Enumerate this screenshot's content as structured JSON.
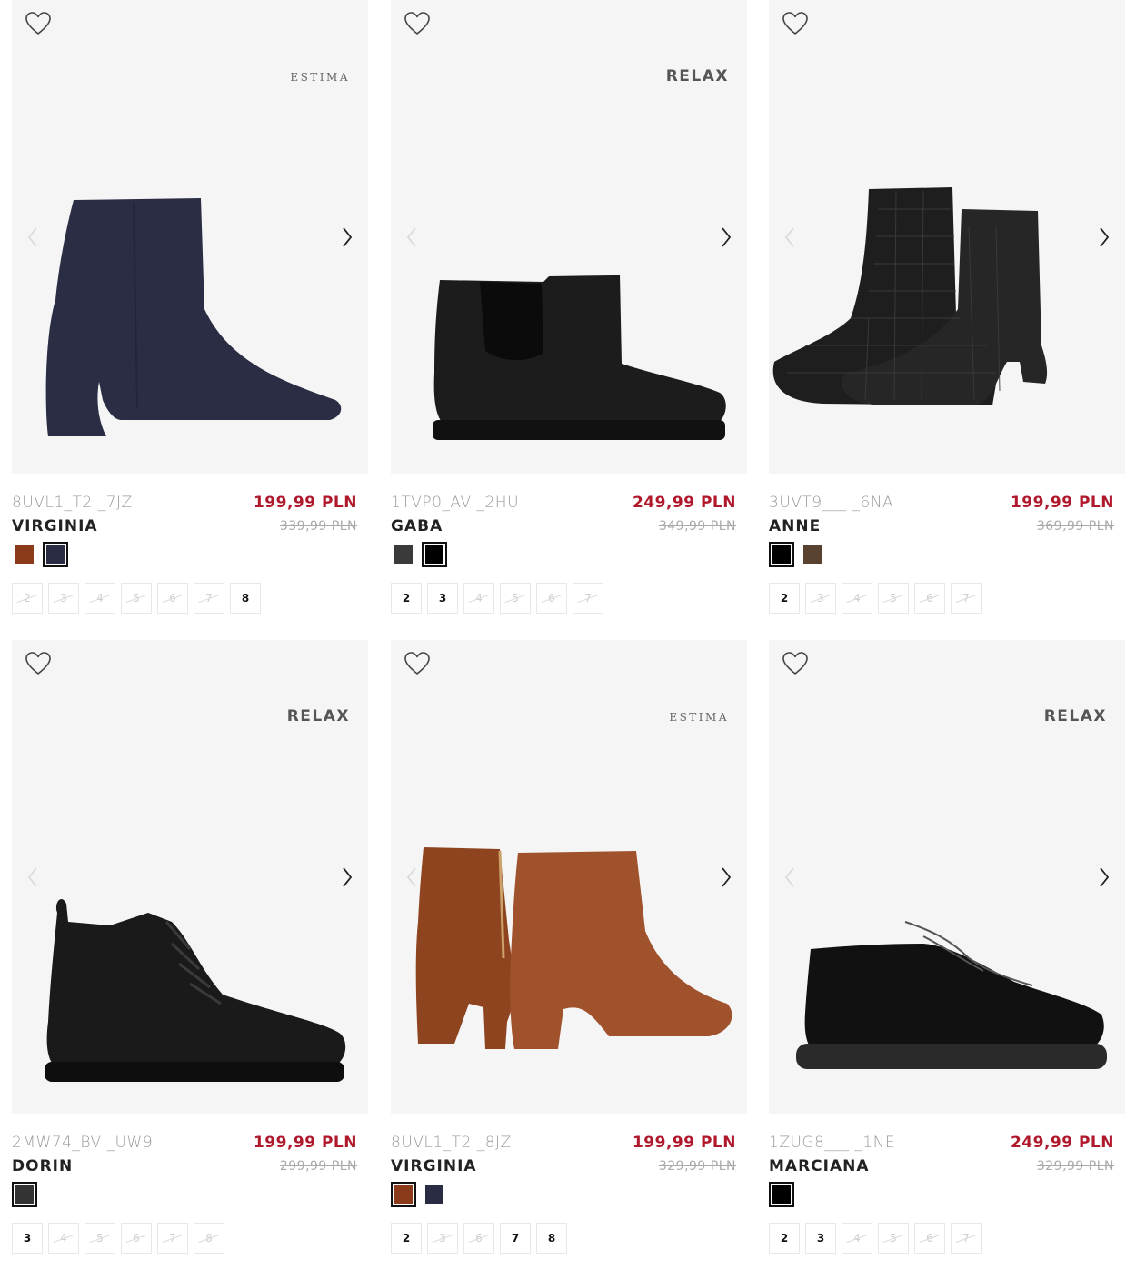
{
  "products": [
    {
      "sku": "8UVL1_T2 _7JZ",
      "name": "VIRGINIA",
      "price": "199,99 PLN",
      "old_price": "339,99 PLN",
      "brand": "ESTIMA",
      "brand_style": "serif",
      "shoe_type": "heel-ankle-boot",
      "shoe_color": "#2b2d45",
      "swatches": [
        {
          "color": "#8b3a1a",
          "selected": false
        },
        {
          "color": "#2a2c43",
          "selected": true
        }
      ],
      "sizes": [
        {
          "label": "2",
          "available": false
        },
        {
          "label": "3",
          "available": false
        },
        {
          "label": "4",
          "available": false
        },
        {
          "label": "5",
          "available": false
        },
        {
          "label": "6",
          "available": false
        },
        {
          "label": "7",
          "available": false
        },
        {
          "label": "8",
          "available": true
        }
      ]
    },
    {
      "sku": "1TVP0_AV _2HU",
      "name": "GABA",
      "price": "249,99 PLN",
      "old_price": "349,99 PLN",
      "brand": "RELAX",
      "brand_style": "sans",
      "shoe_type": "chelsea-boot",
      "shoe_color": "#1c1c1c",
      "swatches": [
        {
          "color": "#3a3a3a",
          "selected": false
        },
        {
          "color": "#000000",
          "selected": true
        }
      ],
      "sizes": [
        {
          "label": "2",
          "available": true
        },
        {
          "label": "3",
          "available": true
        },
        {
          "label": "4",
          "available": false
        },
        {
          "label": "5",
          "available": false
        },
        {
          "label": "6",
          "available": false
        },
        {
          "label": "7",
          "available": false
        }
      ]
    },
    {
      "sku": "3UVT9___ _6NA",
      "name": "ANNE",
      "price": "199,99 PLN",
      "old_price": "369,99 PLN",
      "brand": "",
      "brand_style": "sans",
      "shoe_type": "croc-boot-pair",
      "shoe_color": "#1e1e1e",
      "swatches": [
        {
          "color": "#000000",
          "selected": true
        },
        {
          "color": "#5a4230",
          "selected": false
        }
      ],
      "sizes": [
        {
          "label": "2",
          "available": true
        },
        {
          "label": "3",
          "available": false
        },
        {
          "label": "4",
          "available": false
        },
        {
          "label": "5",
          "available": false
        },
        {
          "label": "6",
          "available": false
        },
        {
          "label": "7",
          "available": false
        }
      ]
    },
    {
      "sku": "2MW74_BV _UW9",
      "name": "DORIN",
      "price": "199,99 PLN",
      "old_price": "299,99 PLN",
      "brand": "RELAX",
      "brand_style": "sans",
      "shoe_type": "lace-up-boot",
      "shoe_color": "#1a1a1a",
      "swatches": [
        {
          "color": "#333333",
          "selected": true
        }
      ],
      "sizes": [
        {
          "label": "3",
          "available": true
        },
        {
          "label": "4",
          "available": false
        },
        {
          "label": "5",
          "available": false
        },
        {
          "label": "6",
          "available": false
        },
        {
          "label": "7",
          "available": false
        },
        {
          "label": "8",
          "available": false
        }
      ]
    },
    {
      "sku": "8UVL1_T2 _8JZ",
      "name": "VIRGINIA",
      "price": "199,99 PLN",
      "old_price": "329,99 PLN",
      "brand": "ESTIMA",
      "brand_style": "serif",
      "shoe_type": "suede-boot-pair",
      "shoe_color": "#a0522d",
      "swatches": [
        {
          "color": "#8b3a1a",
          "selected": true
        },
        {
          "color": "#2a2c43",
          "selected": false
        }
      ],
      "sizes": [
        {
          "label": "2",
          "available": true
        },
        {
          "label": "3",
          "available": false
        },
        {
          "label": "6",
          "available": false
        },
        {
          "label": "7",
          "available": true
        },
        {
          "label": "8",
          "available": true
        }
      ]
    },
    {
      "sku": "1ZUG8___ _1NE",
      "name": "MARCIANA",
      "price": "249,99 PLN",
      "old_price": "329,99 PLN",
      "brand": "RELAX",
      "brand_style": "sans",
      "shoe_type": "suede-sneaker",
      "shoe_color": "#111111",
      "swatches": [
        {
          "color": "#000000",
          "selected": true
        }
      ],
      "sizes": [
        {
          "label": "2",
          "available": true
        },
        {
          "label": "3",
          "available": true
        },
        {
          "label": "4",
          "available": false
        },
        {
          "label": "5",
          "available": false
        },
        {
          "label": "6",
          "available": false
        },
        {
          "label": "7",
          "available": false
        }
      ]
    }
  ],
  "icons": {
    "favorite": "heart-outline-icon",
    "prev": "chevron-left-icon",
    "next": "chevron-right-icon"
  }
}
